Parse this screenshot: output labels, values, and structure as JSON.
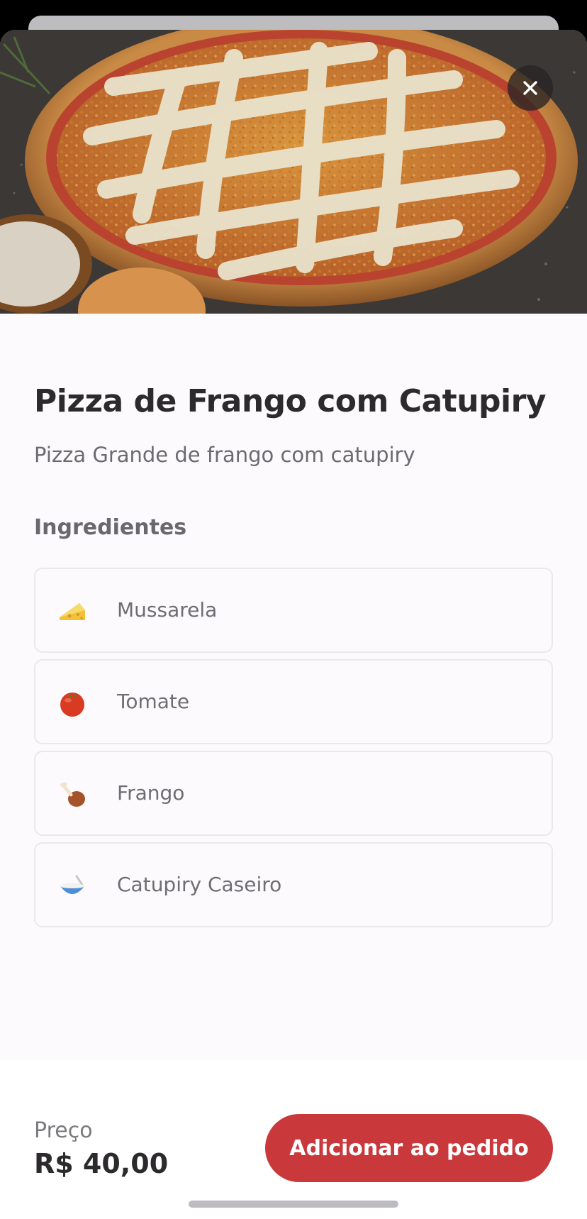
{
  "product": {
    "title": "Pizza de Frango com Catupiry",
    "description": "Pizza Grande de frango com catupiry"
  },
  "ingredients_section": {
    "title": "Ingredientes",
    "items": [
      {
        "label": "Mussarela",
        "icon": "cheese-icon"
      },
      {
        "label": "Tomate",
        "icon": "tomato-icon"
      },
      {
        "label": "Frango",
        "icon": "chicken-leg-icon"
      },
      {
        "label": "Catupiry Caseiro",
        "icon": "bowl-icon"
      }
    ]
  },
  "footer": {
    "price_label": "Preço",
    "price_value": "R$ 40,00",
    "add_button_label": "Adicionar ao pedido"
  },
  "colors": {
    "accent": "#c9383b",
    "text_primary": "#2c2a2d",
    "text_secondary": "#6c6a6e",
    "background": "#fcfafc"
  }
}
